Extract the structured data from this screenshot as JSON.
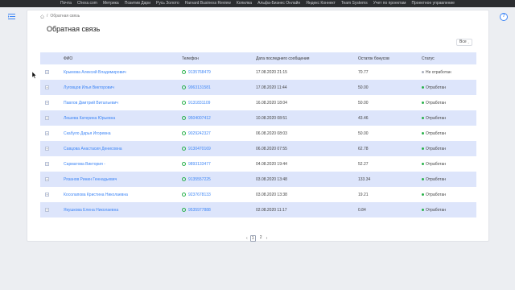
{
  "bookmarks": [
    "Почта",
    "Chess.com",
    "Метрика",
    "Позитив Дари",
    "Русь Золото",
    "Harvard Business Review",
    "Копилка",
    "Альфа-Бизнес Онлайн",
    "Яндекс Коннект",
    "Team Systems",
    "Учет по проектам",
    "Проектное управление"
  ],
  "breadcrumb": {
    "current": "Обратная связь"
  },
  "page": {
    "title": "Обратная связь"
  },
  "filter": {
    "selected": "Все"
  },
  "table": {
    "headers": {
      "name": "ФИО",
      "phone": "Телефон",
      "date": "Дата последнего сообщения",
      "bonus": "Остаток бонусов",
      "status": "Статус"
    },
    "rows": [
      {
        "name": "Крымова Алексий Владимирович",
        "phone": "9135768479",
        "date": "17.08.2020 21:15",
        "bonus": "70.77",
        "status": "Не отработан",
        "status_color": "#a9afbb"
      },
      {
        "name": "Луговцов Илья Викторович",
        "phone": "9963131581",
        "date": "17.08.2020 11:44",
        "bonus": "50.00",
        "status": "Отработан",
        "status_color": "#2bb24c"
      },
      {
        "name": "Павлов Дмитрий Витальевич",
        "phone": "9131831109",
        "date": "16.08.2020 18:04",
        "bonus": "50.00",
        "status": "Отработан",
        "status_color": "#2bb24c"
      },
      {
        "name": "Лешева Катерина Юрьевна",
        "phone": "9504007412",
        "date": "10.08.2020 08:51",
        "bonus": "43.46",
        "status": "Отработан",
        "status_color": "#2bb24c"
      },
      {
        "name": "Скабуло Дарья Игоревна",
        "phone": "9029242327",
        "date": "06.08.2020 08:03",
        "bonus": "50.00",
        "status": "Отработан",
        "status_color": "#2bb24c"
      },
      {
        "name": "Савцова Анастасия Денисовна",
        "phone": "9130470169",
        "date": "06.08.2020 07:55",
        "bonus": "62.78",
        "status": "Отработан",
        "status_color": "#2bb24c"
      },
      {
        "name": "Сарматова Виктория -",
        "phone": "9893133477",
        "date": "04.08.2020 19:44",
        "bonus": "52.27",
        "status": "Отработан",
        "status_color": "#2bb24c"
      },
      {
        "name": "Рязанов Ринин Геннадьевич",
        "phone": "9135557225",
        "date": "03.08.2020 13:48",
        "bonus": "133.34",
        "status": "Отработан",
        "status_color": "#2bb24c"
      },
      {
        "name": "Косолапова Кристина Николаевна",
        "phone": "9237678133",
        "date": "03.08.2020 13:38",
        "bonus": "19.21",
        "status": "Отработан",
        "status_color": "#2bb24c"
      },
      {
        "name": "Якушкова Елена Николаевна",
        "phone": "9535977888",
        "date": "02.08.2020 11:17",
        "bonus": "0.84",
        "status": "Отработан",
        "status_color": "#2bb24c"
      }
    ]
  },
  "pagination": {
    "pages": [
      "1",
      "2"
    ],
    "current": "1"
  },
  "help": {
    "label": "?"
  }
}
